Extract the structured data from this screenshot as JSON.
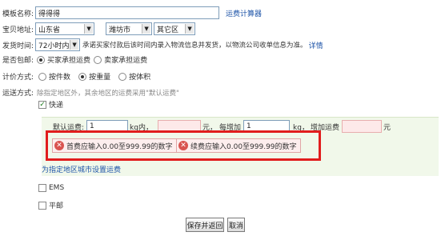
{
  "template_name": {
    "label": "模板名称:",
    "value": "得得得",
    "calc_link": "运费计算器"
  },
  "location": {
    "label": "宝贝地址:",
    "province": "山东省",
    "city": "潍坊市",
    "district": "其它区"
  },
  "ship_time": {
    "label": "发货时间:",
    "value": "72小时内",
    "note": "承诺买家付款后该时间内录入物流信息并发货，以物流公司收单信息为准。",
    "detail_link": "详情"
  },
  "free_shipping": {
    "label": "是否包邮:",
    "opt_buyer": "买家承担运费",
    "opt_seller": "卖家承担运费"
  },
  "pricing": {
    "label": "计价方式:",
    "opt_count": "按件数",
    "opt_weight": "按重量",
    "opt_volume": "按体积"
  },
  "delivery": {
    "label": "运送方式:",
    "hint": "除指定地区外，其余地区的运费采用\"默认运费\"",
    "express_label": "快递",
    "default_fee_label": "默认运费:",
    "first_value": "1",
    "unit_kg": "kg内，",
    "unit_yuan1": "元，",
    "each_add_label": "每增加",
    "add_value": "1",
    "unit_kg2": "kg，",
    "add_fee_label": "增加运费",
    "unit_yuan2": "元",
    "error_first": "首费应输入0.00至999.99的数字",
    "error_continue": "续费应输入0.00至999.99的数字",
    "area_link": "为指定地区城市设置运费",
    "ems_label": "EMS",
    "mail_label": "平邮"
  },
  "buttons": {
    "save": "保存并返回",
    "cancel": "取消"
  }
}
